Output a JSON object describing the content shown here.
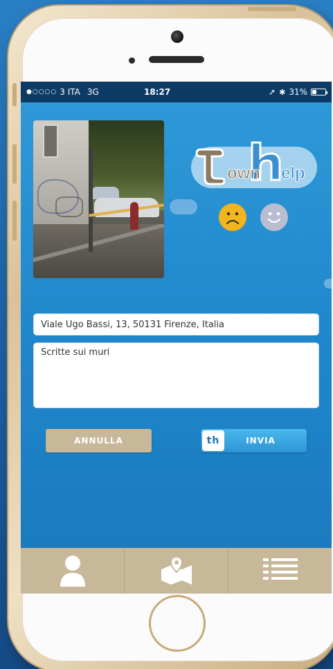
{
  "status_bar": {
    "carrier": "3 ITA",
    "network": "3G",
    "time": "18:27",
    "battery_percent_label": "31%",
    "battery_level": 0.31
  },
  "logo": {
    "text": "townhelp"
  },
  "feedback": {
    "sad_icon": "sad-face-icon",
    "happy_icon": "happy-face-icon"
  },
  "form": {
    "address_value": "Viale Ugo Bassi, 13, 50131 Firenze, Italia",
    "description_value": "Scritte sui muri"
  },
  "actions": {
    "cancel_label": "ANNULLA",
    "send_label": "INVIA",
    "send_icon_text": "th"
  },
  "tabs": [
    {
      "icon": "user-icon"
    },
    {
      "icon": "map-pin-icon"
    },
    {
      "icon": "list-icon"
    }
  ],
  "colors": {
    "screen_blue": "#1f87cb",
    "tan": "#c8b89a",
    "sad_yellow": "#f2b51d",
    "status_bar": "#0c3b66"
  }
}
